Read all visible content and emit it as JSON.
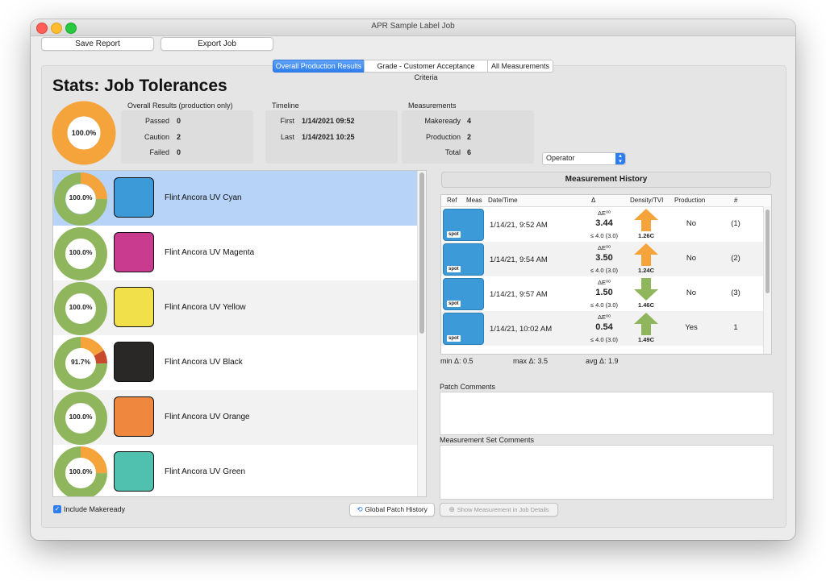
{
  "window": {
    "title": "APR Sample Label Job"
  },
  "toolbar": {
    "save_report": "Save Report",
    "export_job": "Export Job"
  },
  "tabs": [
    {
      "label": "Overall Production Results",
      "active": true
    },
    {
      "label": "Grade - Customer Acceptance Criteria",
      "active": false
    },
    {
      "label": "All Measurements",
      "active": false
    }
  ],
  "page_title": "Stats: Job Tolerances",
  "overall": {
    "donut_label": "100.0%",
    "header": "Overall Results (production only)",
    "passed_label": "Passed",
    "passed": "0",
    "caution_label": "Caution",
    "caution": "2",
    "failed_label": "Failed",
    "failed": "0"
  },
  "timeline": {
    "header": "Timeline",
    "first_label": "First",
    "first": "1/14/2021 09:52",
    "last_label": "Last",
    "last": "1/14/2021 10:25"
  },
  "measurements": {
    "header": "Measurements",
    "makeready_label": "Makeready",
    "makeready": "4",
    "production_label": "Production",
    "production": "2",
    "total_label": "Total",
    "total": "6"
  },
  "operator_select": {
    "value": "Operator"
  },
  "patches": [
    {
      "name": "Flint Ancora UV Cyan",
      "pct_label": "100.0%",
      "color": "#3b9ad7",
      "selected": true,
      "pass": 0.75,
      "caution": 0.25,
      "fail": 0.0
    },
    {
      "name": "Flint Ancora UV Magenta",
      "pct_label": "100.0%",
      "color": "#c93b8e",
      "selected": false,
      "pass": 1.0,
      "caution": 0.0,
      "fail": 0.0
    },
    {
      "name": "Flint Ancora UV Yellow",
      "pct_label": "100.0%",
      "color": "#f2e04a",
      "selected": false,
      "pass": 1.0,
      "caution": 0.0,
      "fail": 0.0
    },
    {
      "name": "Flint Ancora UV Black",
      "pct_label": "91.7%",
      "color": "#2a2727",
      "selected": false,
      "pass": 0.75,
      "caution": 0.167,
      "fail": 0.083
    },
    {
      "name": "Flint Ancora UV Orange",
      "pct_label": "100.0%",
      "color": "#f0873e",
      "selected": false,
      "pass": 1.0,
      "caution": 0.0,
      "fail": 0.0
    },
    {
      "name": "Flint Ancora UV Green",
      "pct_label": "100.0%",
      "color": "#4fc1ae",
      "selected": false,
      "pass": 0.75,
      "caution": 0.25,
      "fail": 0.0
    }
  ],
  "colors": {
    "pass": "#8fb65d",
    "caution": "#f5a33b",
    "fail": "#c9492f",
    "accent": "#2f7ef0",
    "selection": "#b7d3f8"
  },
  "history": {
    "title": "Measurement History",
    "columns": {
      "ref": "Ref",
      "meas": "Meas",
      "date": "Date/Time",
      "delta": "Δ",
      "density": "Density/TVI",
      "production": "Production",
      "num": "#"
    },
    "rows": [
      {
        "spot": "spot",
        "date": "1/14/21, 9:52 AM",
        "de_label": "ΔE⁰⁰",
        "de": "3.44",
        "tol": "≤ 4.0 (3.0)",
        "dir": "up",
        "arrow_color": "#f5a33b",
        "density": "1.26C",
        "production": "No",
        "num": "(1)"
      },
      {
        "spot": "spot",
        "date": "1/14/21, 9:54 AM",
        "de_label": "ΔE⁰⁰",
        "de": "3.50",
        "tol": "≤ 4.0 (3.0)",
        "dir": "up",
        "arrow_color": "#f5a33b",
        "density": "1.24C",
        "production": "No",
        "num": "(2)"
      },
      {
        "spot": "spot",
        "date": "1/14/21, 9:57 AM",
        "de_label": "ΔE⁰⁰",
        "de": "1.50",
        "tol": "≤ 4.0 (3.0)",
        "dir": "down",
        "arrow_color": "#8fb65d",
        "density": "1.46C",
        "production": "No",
        "num": "(3)"
      },
      {
        "spot": "spot",
        "date": "1/14/21, 10:02 AM",
        "de_label": "ΔE⁰⁰",
        "de": "0.54",
        "tol": "≤ 4.0 (3.0)",
        "dir": "up",
        "arrow_color": "#8fb65d",
        "density": "1.49C",
        "production": "Yes",
        "num": "1"
      }
    ],
    "min": "min Δ: 0.5",
    "max": "max Δ: 3.5",
    "avg": "avg Δ: 1.9"
  },
  "patch_comments": {
    "label": "Patch Comments",
    "value": ""
  },
  "set_comments": {
    "label": "Measurement Set Comments",
    "value": ""
  },
  "footer": {
    "include_makeready": "Include Makeready",
    "global_patch_history": "Global Patch History",
    "show_measurement": "Show Measurement in Job Details"
  }
}
